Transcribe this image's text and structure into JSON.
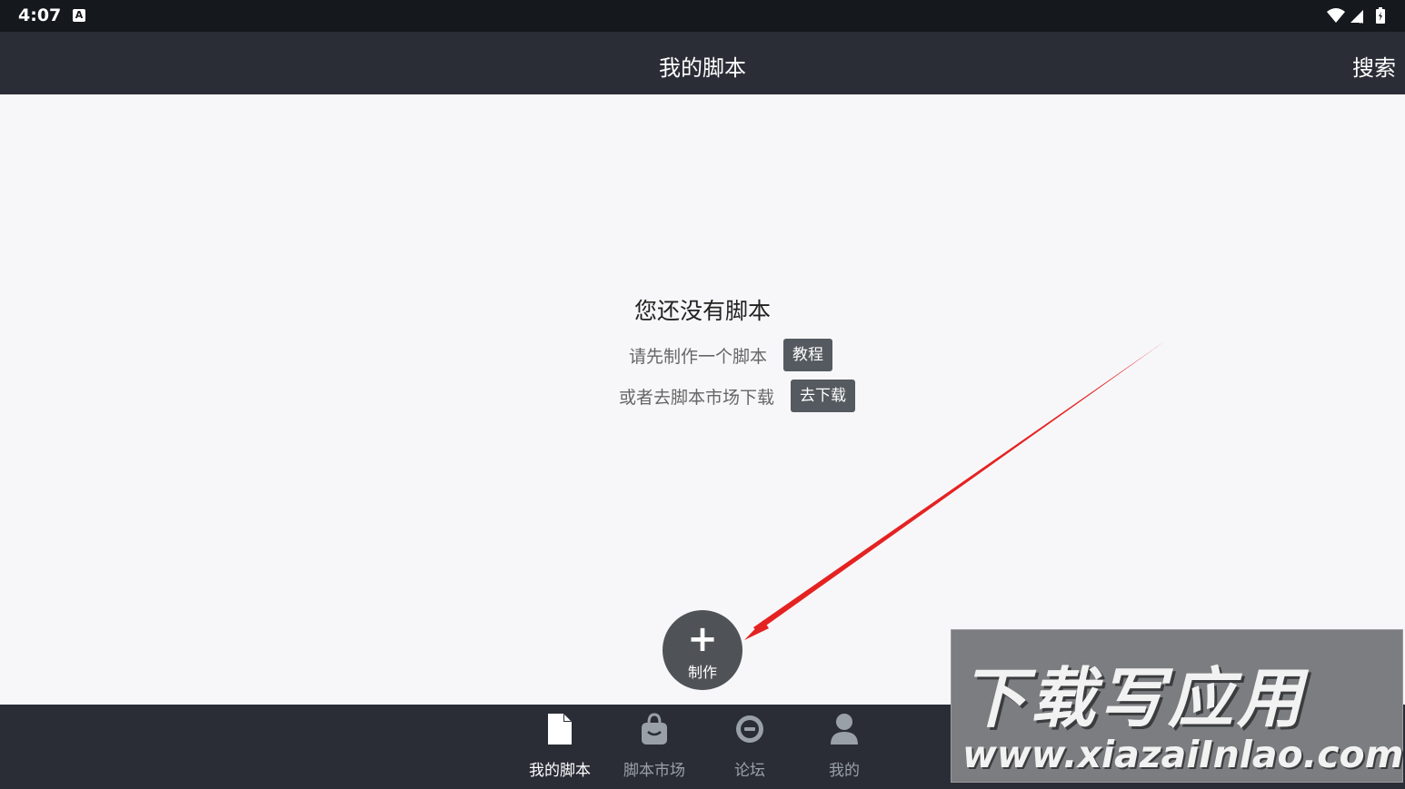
{
  "status_bar": {
    "time": "4:07",
    "notification_icon": "A"
  },
  "app_bar": {
    "title": "我的脚本",
    "search_label": "搜索"
  },
  "empty_state": {
    "title": "您还没有脚本",
    "line1_text": "请先制作一个脚本",
    "line1_button": "教程",
    "line2_text": "或者去脚本市场下载",
    "line2_button": "去下载"
  },
  "fab": {
    "plus": "+",
    "label": "制作"
  },
  "bottom_nav": {
    "items": [
      {
        "label": "我的脚本",
        "icon": "document-icon",
        "active": true
      },
      {
        "label": "脚本市场",
        "icon": "shopping-bag-icon",
        "active": false
      },
      {
        "label": "论坛",
        "icon": "chat-icon",
        "active": false
      },
      {
        "label": "我的",
        "icon": "person-icon",
        "active": false
      }
    ]
  },
  "watermark": {
    "title": "下载写应用",
    "url": "www.xiazaiInlao.com"
  },
  "colors": {
    "status_bar": "#15181d",
    "app_bar": "#2a2d36",
    "background": "#f7f7f9",
    "chip": "#555a60",
    "fab": "#4f5358",
    "arrow": "#e52222"
  }
}
